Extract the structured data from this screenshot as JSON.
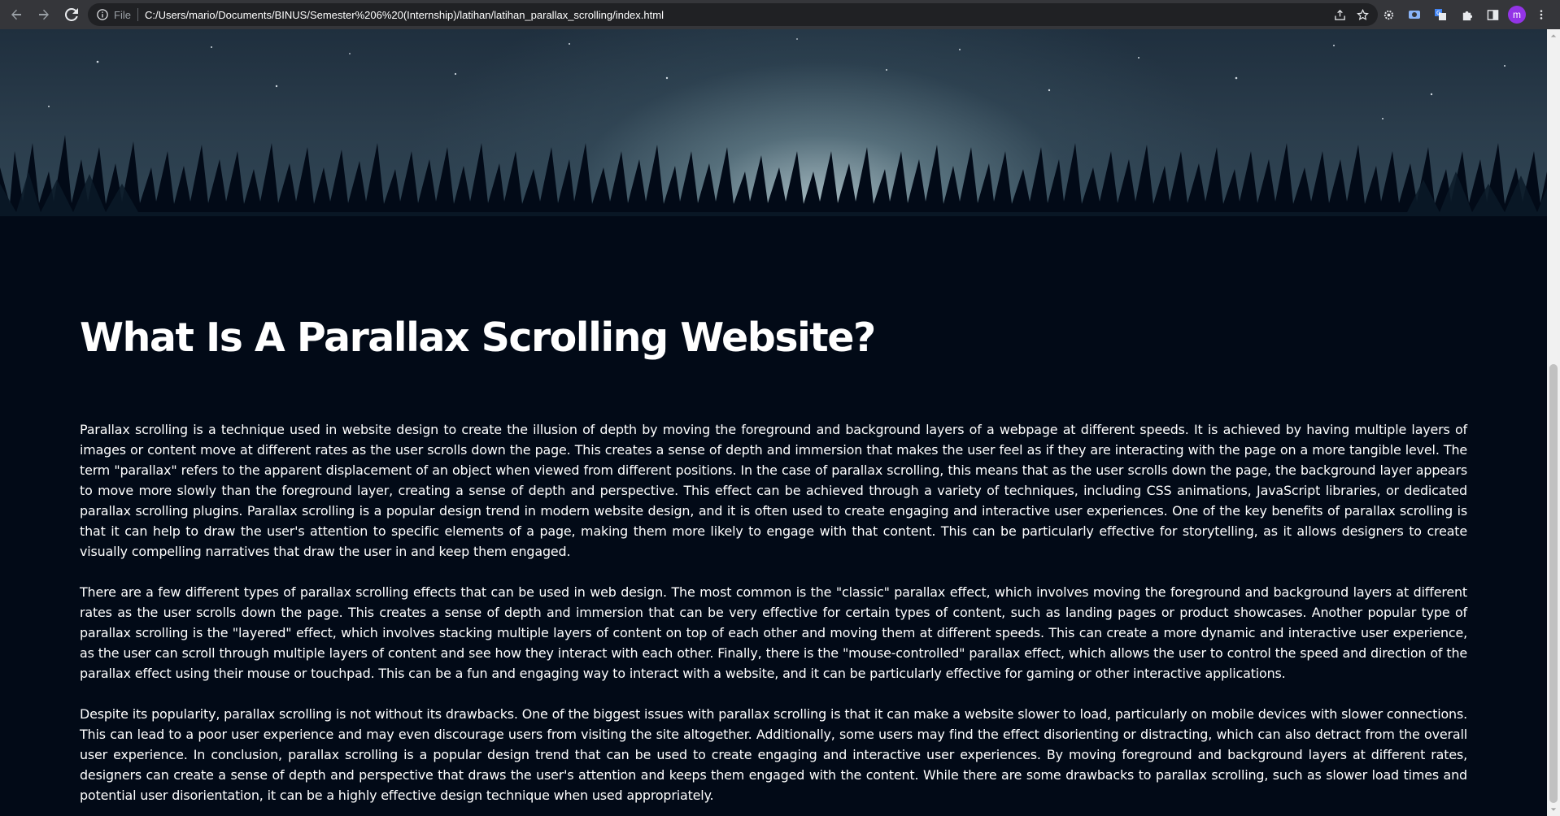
{
  "browser": {
    "file_label": "File",
    "url": "C:/Users/mario/Documents/BINUS/Semester%206%20(Internship)/latihan/latihan_parallax_scrolling/index.html",
    "avatar_letter": "m"
  },
  "article": {
    "title": "What Is A Parallax Scrolling Website?",
    "paragraphs": [
      "Parallax scrolling is a technique used in website design to create the illusion of depth by moving the foreground and background layers of a webpage at different speeds. It is achieved by having multiple layers of images or content move at different rates as the user scrolls down the page. This creates a sense of depth and immersion that makes the user feel as if they are interacting with the page on a more tangible level. The term \"parallax\" refers to the apparent displacement of an object when viewed from different positions. In the case of parallax scrolling, this means that as the user scrolls down the page, the background layer appears to move more slowly than the foreground layer, creating a sense of depth and perspective. This effect can be achieved through a variety of techniques, including CSS animations, JavaScript libraries, or dedicated parallax scrolling plugins. Parallax scrolling is a popular design trend in modern website design, and it is often used to create engaging and interactive user experiences. One of the key benefits of parallax scrolling is that it can help to draw the user's attention to specific elements of a page, making them more likely to engage with that content. This can be particularly effective for storytelling, as it allows designers to create visually compelling narratives that draw the user in and keep them engaged.",
      "There are a few different types of parallax scrolling effects that can be used in web design. The most common is the \"classic\" parallax effect, which involves moving the foreground and background layers at different rates as the user scrolls down the page. This creates a sense of depth and immersion that can be very effective for certain types of content, such as landing pages or product showcases. Another popular type of parallax scrolling is the \"layered\" effect, which involves stacking multiple layers of content on top of each other and moving them at different speeds. This can create a more dynamic and interactive user experience, as the user can scroll through multiple layers of content and see how they interact with each other. Finally, there is the \"mouse-controlled\" parallax effect, which allows the user to control the speed and direction of the parallax effect using their mouse or touchpad. This can be a fun and engaging way to interact with a website, and it can be particularly effective for gaming or other interactive applications.",
      "Despite its popularity, parallax scrolling is not without its drawbacks. One of the biggest issues with parallax scrolling is that it can make a website slower to load, particularly on mobile devices with slower connections. This can lead to a poor user experience and may even discourage users from visiting the site altogether. Additionally, some users may find the effect disorienting or distracting, which can also detract from the overall user experience. In conclusion, parallax scrolling is a popular design trend that can be used to create engaging and interactive user experiences. By moving foreground and background layers at different rates, designers can create a sense of depth and perspective that draws the user's attention and keeps them engaged with the content. While there are some drawbacks to parallax scrolling, such as slower load times and potential user disorientation, it can be a highly effective design technique when used appropriately."
    ]
  },
  "icons": {
    "back": "arrow-left-icon",
    "forward": "arrow-right-icon",
    "reload": "reload-icon",
    "info": "info-icon",
    "share": "share-icon",
    "bookmark": "star-icon",
    "extensions": [
      "gear-extension-icon",
      "screen-capture-icon",
      "translate-icon",
      "puzzle-icon",
      "side-panel-icon"
    ],
    "menu": "kebab-menu-icon"
  },
  "colors": {
    "page_background": "#020a17",
    "chrome_background": "#35363a",
    "avatar": "#9334e6",
    "text": "#ffffff"
  },
  "scroll_position": 0.43
}
